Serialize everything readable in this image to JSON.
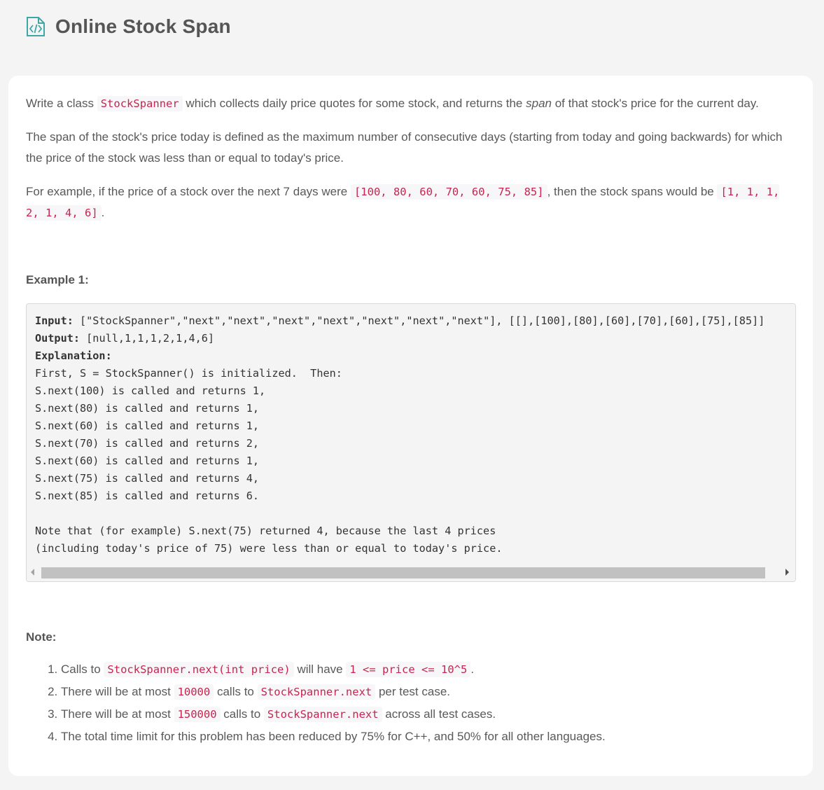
{
  "header": {
    "title": "Online Stock Span",
    "icon": "code-document-icon",
    "icon_color": "#3fa6a6"
  },
  "description": {
    "p1": {
      "before": "Write a class ",
      "code": "StockSpanner",
      "middle": " which collects daily price quotes for some stock, and returns the ",
      "em": "span",
      "after": " of that stock's price for the current day."
    },
    "p2": "The span of the stock's price today is defined as the maximum number of consecutive days (starting from today and going backwards) for which the price of the stock was less than or equal to today's price.",
    "p3": {
      "before": "For example, if the price of a stock over the next 7 days were ",
      "code1": "[100, 80, 60, 70, 60, 75, 85]",
      "middle": ", then the stock spans would be ",
      "code2": "[1, 1, 1, 2, 1, 4, 6]",
      "after": "."
    }
  },
  "example1": {
    "heading": "Example 1:",
    "input_label": "Input:",
    "input_value": " [\"StockSpanner\",\"next\",\"next\",\"next\",\"next\",\"next\",\"next\",\"next\"], [[],[100],[80],[60],[70],[60],[75],[85]]",
    "output_label": "Output:",
    "output_value": " [null,1,1,1,2,1,4,6]",
    "explanation_label": "Explanation:",
    "explanation_lines": [
      "First, S = StockSpanner() is initialized.  Then:",
      "S.next(100) is called and returns 1,",
      "S.next(80) is called and returns 1,",
      "S.next(60) is called and returns 1,",
      "S.next(70) is called and returns 2,",
      "S.next(60) is called and returns 1,",
      "S.next(75) is called and returns 4,",
      "S.next(85) is called and returns 6.",
      "",
      "Note that (for example) S.next(75) returned 4, because the last 4 prices",
      "(including today's price of 75) were less than or equal to today's price."
    ]
  },
  "note": {
    "heading": "Note:",
    "items": [
      {
        "before": "Calls to ",
        "code1": "StockSpanner.next(int price)",
        "middle": " will have ",
        "code2": "1 <= price <= 10^5",
        "after": "."
      },
      {
        "before": "There will be at most ",
        "code1": "10000",
        "middle": " calls to ",
        "code2": "StockSpanner.next",
        "after": " per test case."
      },
      {
        "before": "There will be at most ",
        "code1": "150000",
        "middle": " calls to ",
        "code2": "StockSpanner.next",
        "after": " across all test cases."
      },
      {
        "before": "The total time limit for this problem has been reduced by 75% for C++, and 50% for all other languages.",
        "code1": "",
        "middle": "",
        "code2": "",
        "after": ""
      }
    ]
  },
  "colors": {
    "code_text": "#c7254e",
    "code_bg": "#f7f7f9",
    "page_bg": "#f4f4f4",
    "card_bg": "#ffffff"
  }
}
